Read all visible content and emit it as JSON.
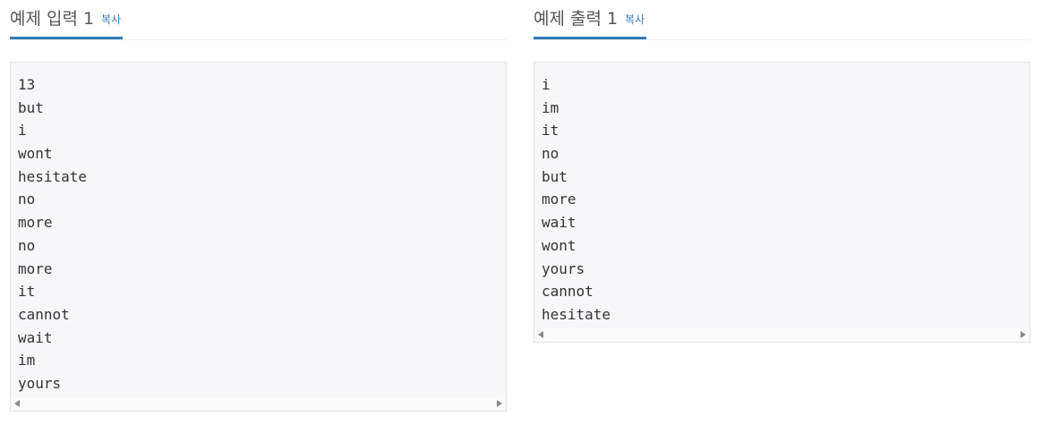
{
  "input_section": {
    "title": "예제 입력 1",
    "copy_label": "복사",
    "lines": [
      "13",
      "but",
      "i",
      "wont",
      "hesitate",
      "no",
      "more",
      "no",
      "more",
      "it",
      "cannot",
      "wait",
      "im",
      "yours"
    ]
  },
  "output_section": {
    "title": "예제 출력 1",
    "copy_label": "복사",
    "lines": [
      "i",
      "im",
      "it",
      "no",
      "but",
      "more",
      "wait",
      "wont",
      "yours",
      "cannot",
      "hesitate"
    ]
  },
  "colors": {
    "accent": "#337ab7",
    "pre_background": "#f7f7f9",
    "pre_border": "#e1e1e8",
    "title_text": "#555555"
  },
  "icons": {
    "scroll_left": "scroll-left-arrow-icon",
    "scroll_right": "scroll-right-arrow-icon"
  }
}
